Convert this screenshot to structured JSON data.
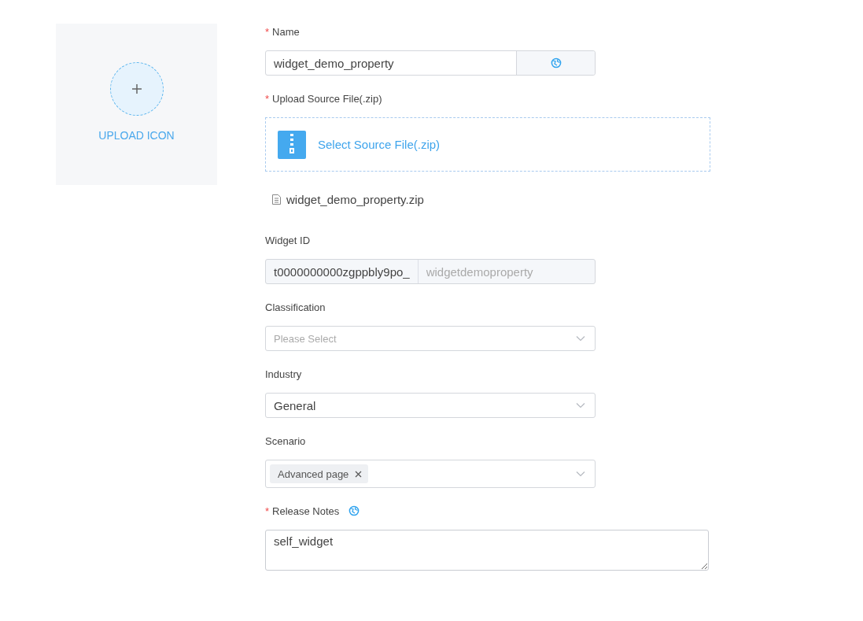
{
  "icon_upload": {
    "label": "UPLOAD ICON"
  },
  "fields": [
    {
      "kind": "translatable",
      "label": "Name",
      "required_mark": "*",
      "value": "widget_demo_property"
    },
    {
      "kind": "upload",
      "label": "Upload Source File(.zip)",
      "required_mark": "*",
      "button": "Select Source File(.zip)",
      "file": "widget_demo_property.zip"
    },
    {
      "kind": "id",
      "label": "Widget ID",
      "prefix": "t0000000000zgppbly9po_",
      "placeholder": "widgetdemoproperty"
    },
    {
      "kind": "select",
      "label": "Classification",
      "placeholder": "Please Select"
    },
    {
      "kind": "select",
      "label": "Industry",
      "value": "General"
    },
    {
      "kind": "tags",
      "label": "Scenario",
      "tags": [
        "Advanced page"
      ]
    },
    {
      "kind": "textarea",
      "label": "Release Notes",
      "required_mark": "*",
      "translatable": true,
      "value": "self_widget"
    }
  ]
}
